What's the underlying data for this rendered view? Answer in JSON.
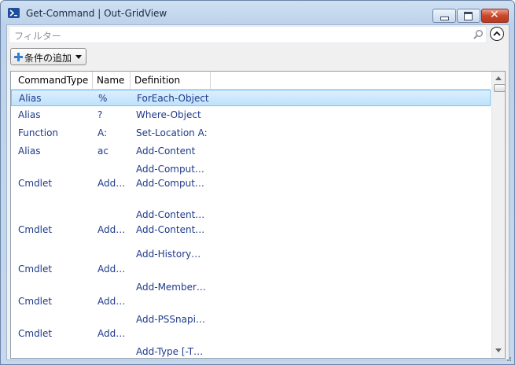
{
  "window": {
    "title": "Get-Command | Out-GridView"
  },
  "filter": {
    "placeholder": "フィルター"
  },
  "toolbar": {
    "add_condition_label": "条件の追加"
  },
  "colors": {
    "accent": "#1e3a8a",
    "selection": "#bfe1fb",
    "close_button": "#c9462a"
  },
  "grid": {
    "columns": [
      "CommandType",
      "Name",
      "Definition"
    ],
    "rows": [
      {
        "type": "Alias",
        "name": "%",
        "def1": "ForEach-Object",
        "def2": ""
      },
      {
        "type": "Alias",
        "name": "?",
        "def1": "Where-Object",
        "def2": ""
      },
      {
        "type": "Function",
        "name": "A:",
        "def1": "Set-Location A:",
        "def2": ""
      },
      {
        "type": "Alias",
        "name": "ac",
        "def1": "Add-Content",
        "def2": ""
      },
      {
        "type": "Cmdlet",
        "name": "Add…",
        "def1": "Add-Comput…",
        "def2": "Add-Comput…"
      },
      {
        "type": "Cmdlet",
        "name": "Add…",
        "def1": "Add-Content…",
        "def2": "Add-Content…"
      },
      {
        "type": "Cmdlet",
        "name": "Add…",
        "def1": "Add-History…",
        "def2": ""
      },
      {
        "type": "Cmdlet",
        "name": "Add…",
        "def1": "Add-Member…",
        "def2": ""
      },
      {
        "type": "Cmdlet",
        "name": "Add…",
        "def1": "Add-PSSnapi…",
        "def2": ""
      },
      {
        "type": "",
        "name": "",
        "def1": "Add-Type [-T…",
        "def2": ""
      }
    ]
  },
  "icons": {
    "app": "powershell-icon",
    "search": "search-icon",
    "collapse": "chevron-up-circle-icon",
    "add": "plus-icon",
    "dropdown": "caret-down-icon"
  }
}
